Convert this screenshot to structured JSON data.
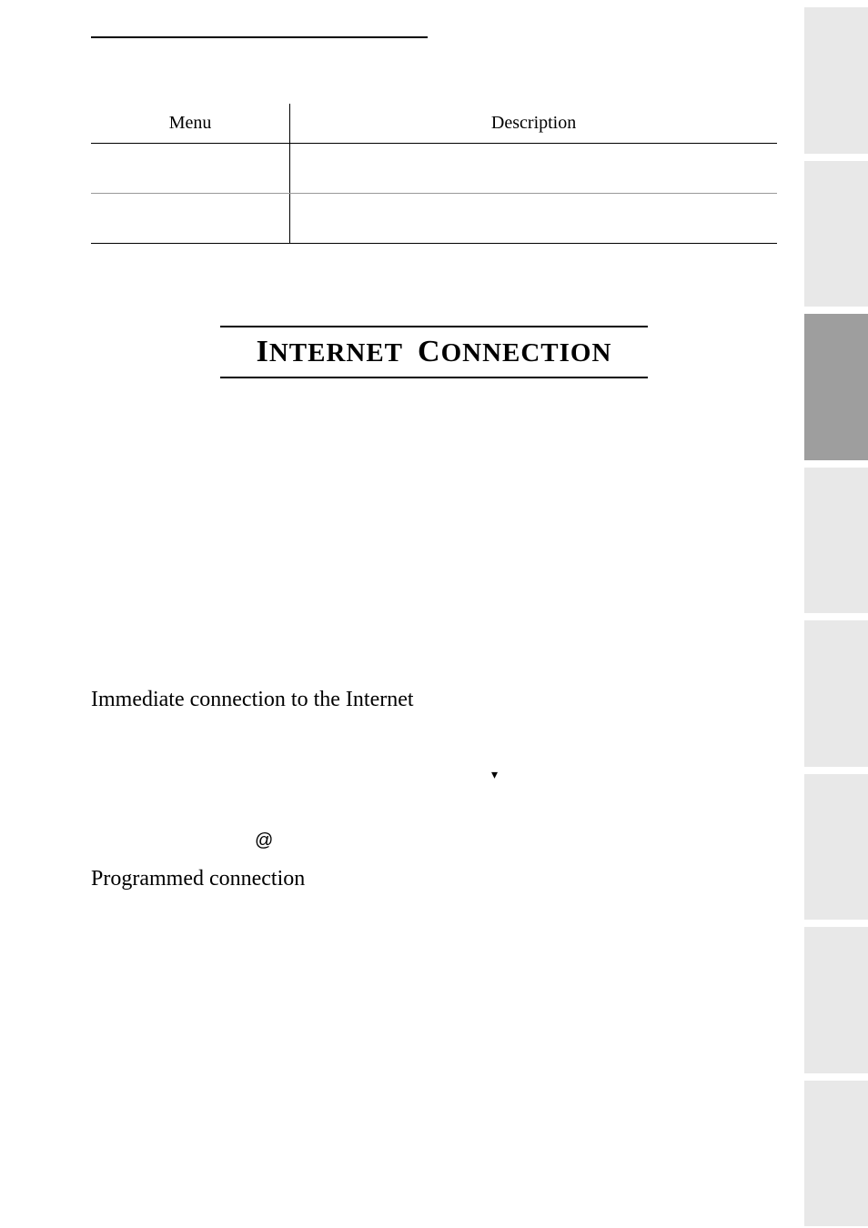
{
  "table": {
    "headers": {
      "menu": "Menu",
      "description": "Description"
    }
  },
  "section_title": {
    "first_cap": "I",
    "first_rest": "NTERNET",
    "second_cap": "C",
    "second_rest": "ONNECTION"
  },
  "subheadings": {
    "immediate": "Immediate connection to the Internet",
    "programmed": "Programmed connection"
  },
  "icons": {
    "down": "▾",
    "at": "@"
  }
}
